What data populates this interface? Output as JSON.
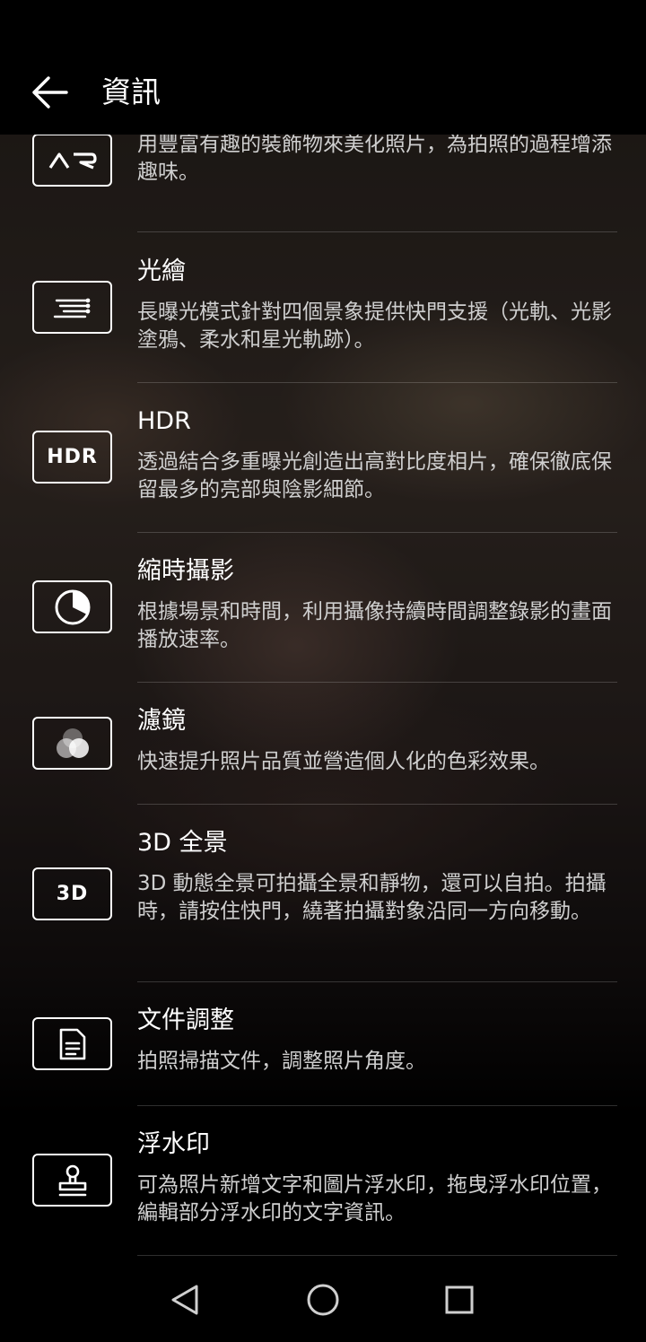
{
  "header": {
    "title": "資訊",
    "back_icon": "arrow-left-icon"
  },
  "items": [
    {
      "id": "ar",
      "icon": "ar-icon",
      "icon_text": "AR",
      "title": "",
      "desc": "用豐富有趣的裝飾物來美化照片，為拍照的過程增添趣味。"
    },
    {
      "id": "light-painting",
      "icon": "light-trails-icon",
      "title": "光繪",
      "desc": "長曝光模式針對四個景象提供快門支援（光軌、光影塗鴉、柔水和星光軌跡）。"
    },
    {
      "id": "hdr",
      "icon": "hdr-icon",
      "icon_text": "HDR",
      "title": "HDR",
      "desc": "透過結合多重曝光創造出高對比度相片，確保徹底保留最多的亮部與陰影細節。"
    },
    {
      "id": "time-lapse",
      "icon": "time-lapse-icon",
      "title": "縮時攝影",
      "desc": "根據場景和時間，利用攝像持續時間調整錄影的畫面播放速率。"
    },
    {
      "id": "filter",
      "icon": "filter-icon",
      "title": "濾鏡",
      "desc": "快速提升照片品質並營造個人化的色彩效果。"
    },
    {
      "id": "3d-panorama",
      "icon": "3d-icon",
      "icon_text": "3D",
      "title": "3D 全景",
      "desc": "3D 動態全景可拍攝全景和靜物，還可以自拍。拍攝時，請按住快門，繞著拍攝對象沿同一方向移動。"
    },
    {
      "id": "document",
      "icon": "document-icon",
      "title": "文件調整",
      "desc": "拍照掃描文件，調整照片角度。"
    },
    {
      "id": "watermark",
      "icon": "stamp-icon",
      "title": "浮水印",
      "desc": "可為照片新增文字和圖片浮水印，拖曳浮水印位置，編輯部分浮水印的文字資訊。"
    }
  ],
  "navbar": {
    "back": "nav-back-icon",
    "home": "nav-home-icon",
    "recents": "nav-recents-icon"
  }
}
